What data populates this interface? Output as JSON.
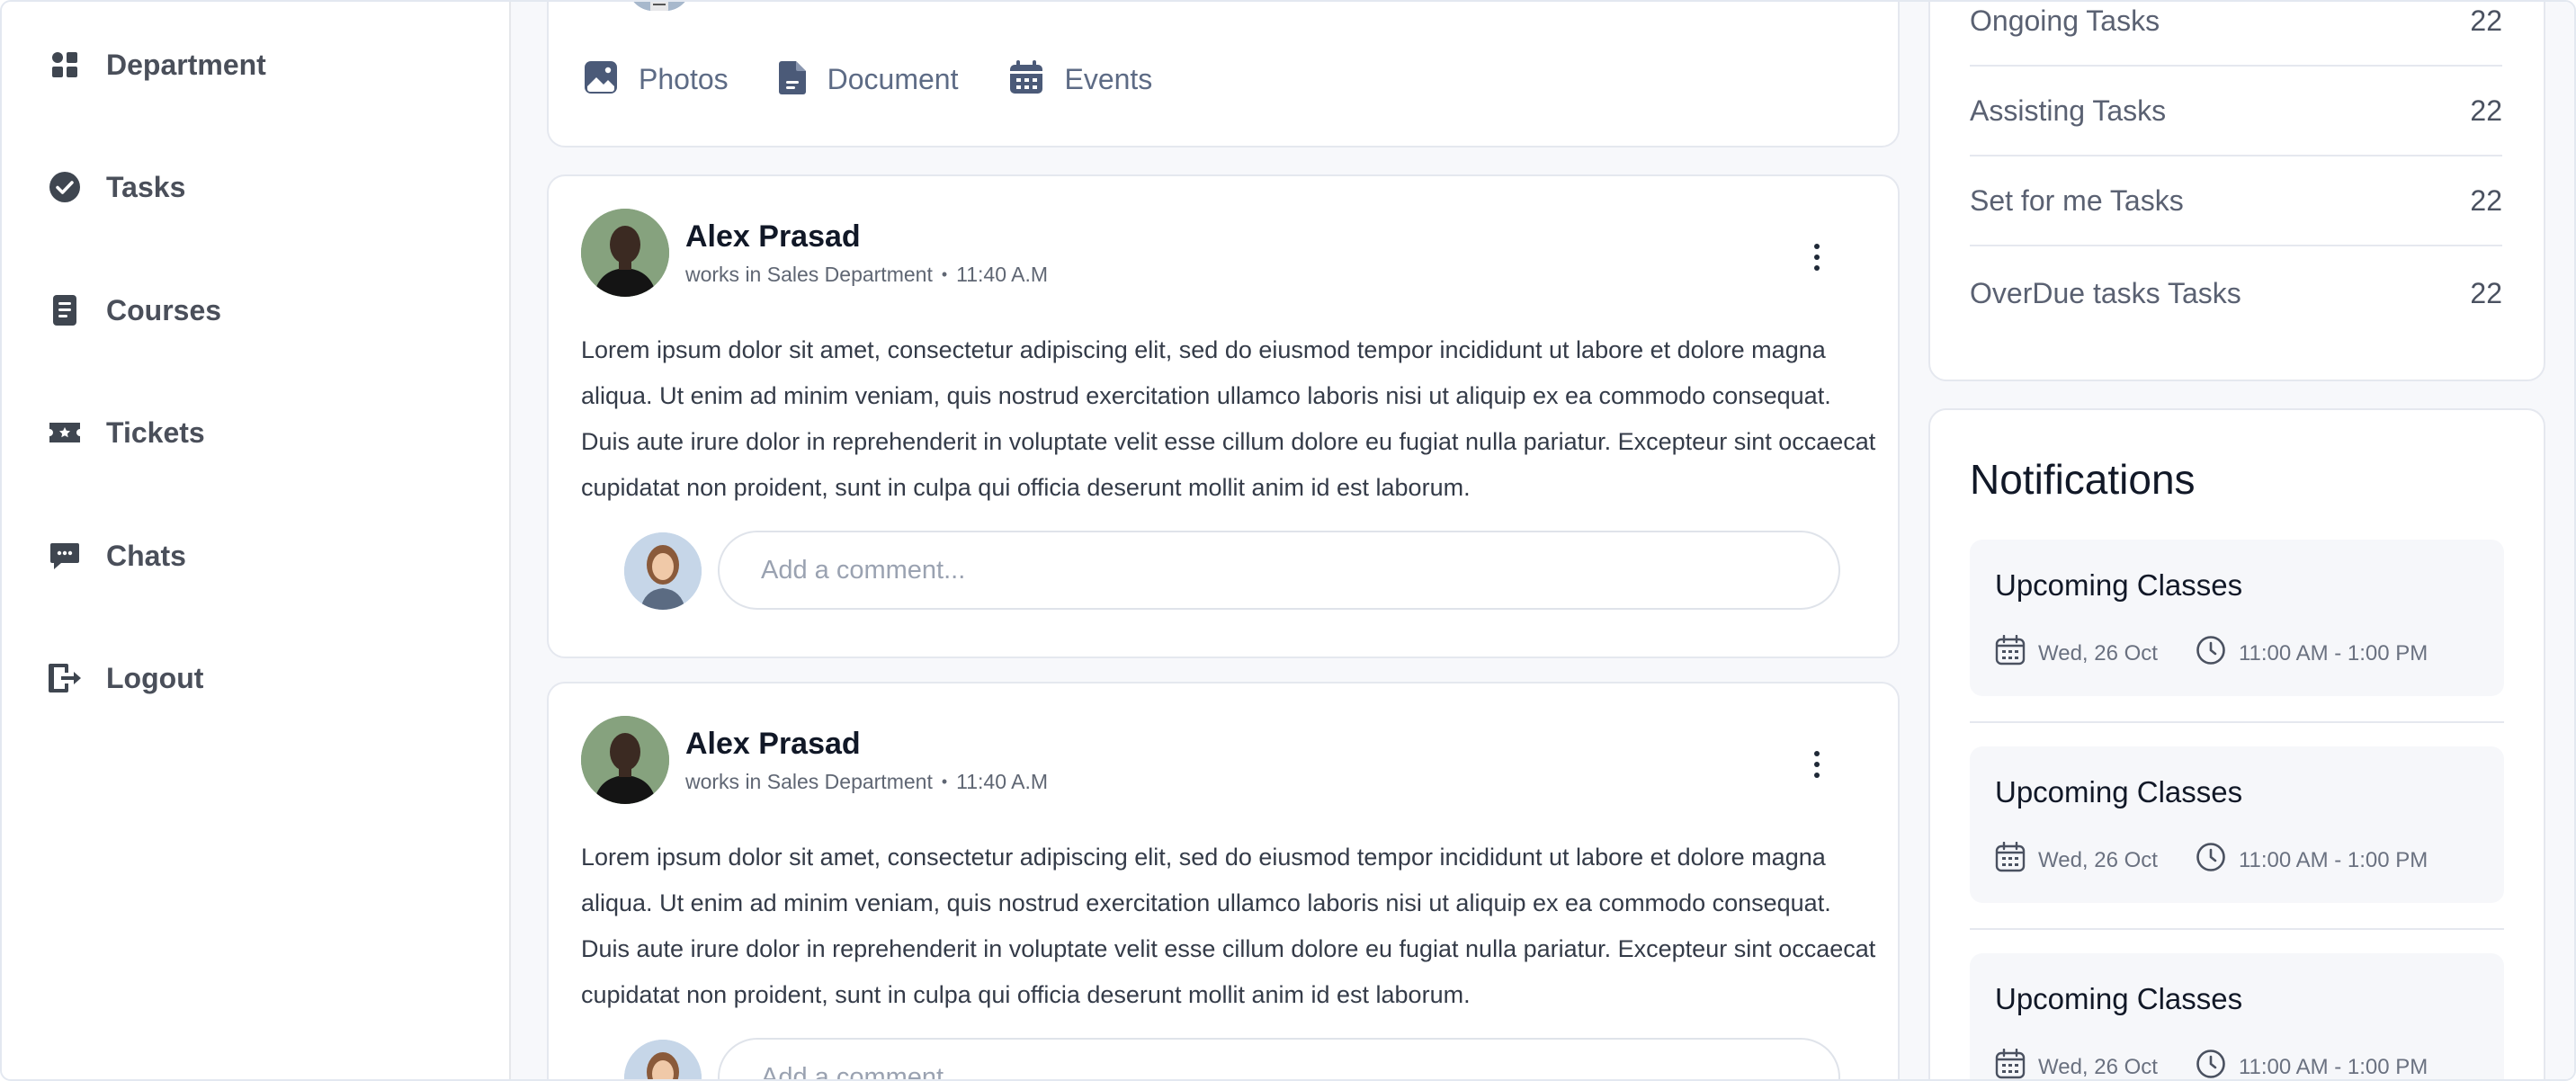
{
  "sidebar": {
    "items": [
      {
        "label": "Department",
        "icon": "grid-icon"
      },
      {
        "label": "Tasks",
        "icon": "check-circle-icon"
      },
      {
        "label": "Courses",
        "icon": "book-icon"
      },
      {
        "label": "Tickets",
        "icon": "ticket-icon"
      },
      {
        "label": "Chats",
        "icon": "chat-icon"
      },
      {
        "label": "Logout",
        "icon": "logout-icon"
      }
    ]
  },
  "composer": {
    "actions": [
      {
        "label": "Photos",
        "icon": "image-icon"
      },
      {
        "label": "Document",
        "icon": "document-icon"
      },
      {
        "label": "Events",
        "icon": "calendar-icon"
      }
    ]
  },
  "posts": [
    {
      "author": "Alex Prasad",
      "department": "works in Sales Department",
      "time": "11:40 A.M",
      "body": "Lorem ipsum dolor sit amet, consectetur adipiscing elit, sed do eiusmod tempor incididunt ut labore et dolore magna aliqua. Ut enim ad minim veniam, quis nostrud exercitation ullamco laboris nisi ut aliquip ex ea commodo consequat. Duis aute irure dolor in reprehenderit in voluptate velit esse cillum dolore eu fugiat nulla pariatur. Excepteur sint occaecat cupidatat non proident, sunt in culpa qui officia deserunt mollit anim id est laborum.",
      "comment_placeholder": "Add a comment..."
    },
    {
      "author": "Alex Prasad",
      "department": "works in Sales Department",
      "time": "11:40 A.M",
      "body": "Lorem ipsum dolor sit amet, consectetur adipiscing elit, sed do eiusmod tempor incididunt ut labore et dolore magna aliqua. Ut enim ad minim veniam, quis nostrud exercitation ullamco laboris nisi ut aliquip ex ea commodo consequat. Duis aute irure dolor in reprehenderit in voluptate velit esse cillum dolore eu fugiat nulla pariatur. Excepteur sint occaecat cupidatat non proident, sunt in culpa qui officia deserunt mollit anim id est laborum.",
      "comment_placeholder": "Add a comment..."
    }
  ],
  "task_stats": [
    {
      "label": "Ongoing Tasks",
      "count": "22"
    },
    {
      "label": "Assisting Tasks",
      "count": "22"
    },
    {
      "label": "Set for me Tasks",
      "count": "22"
    },
    {
      "label": "OverDue tasks Tasks",
      "count": "22"
    }
  ],
  "notifications": {
    "title": "Notifications",
    "items": [
      {
        "title": "Upcoming Classes",
        "date": "Wed, 26 Oct",
        "time": "11:00 AM - 1:00 PM"
      },
      {
        "title": "Upcoming Classes",
        "date": "Wed, 26 Oct",
        "time": "11:00 AM - 1:00 PM"
      },
      {
        "title": "Upcoming Classes",
        "date": "Wed, 26 Oct",
        "time": "11:00 AM - 1:00 PM"
      }
    ]
  },
  "colors": {
    "icon": "#3f4650",
    "accent_icon": "#4b5a78",
    "background": "#f7f8fb"
  }
}
